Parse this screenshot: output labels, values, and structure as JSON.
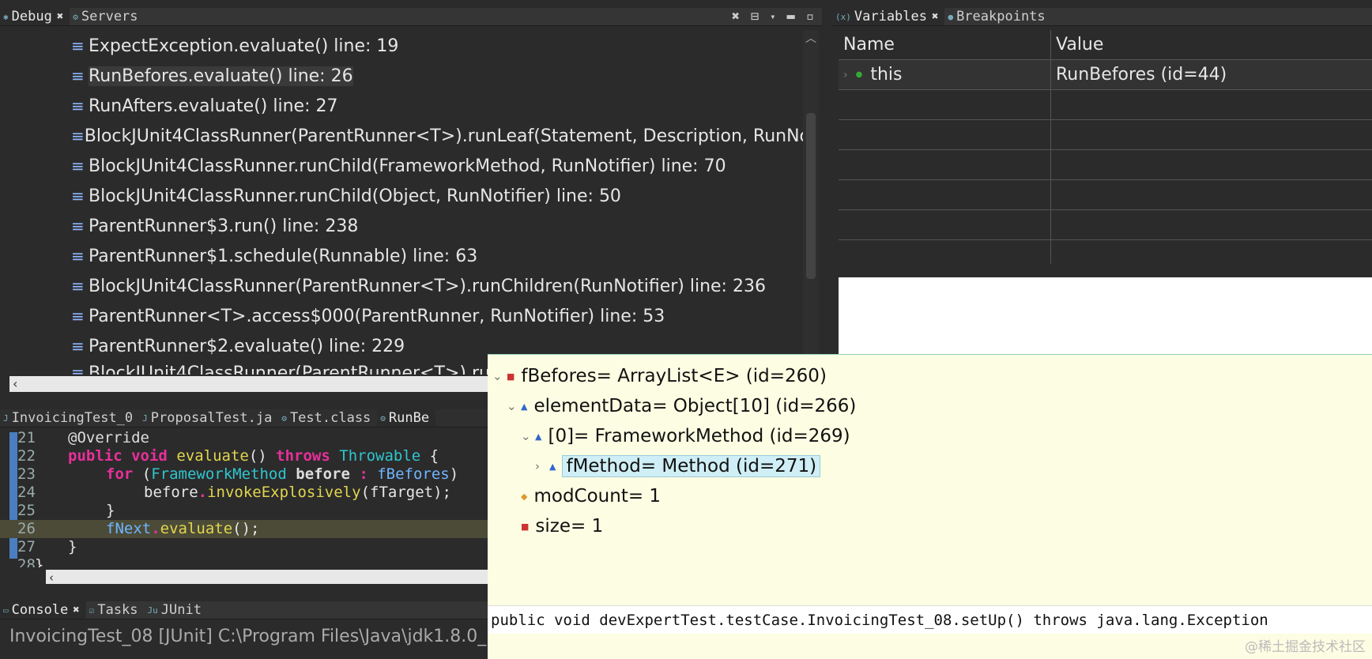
{
  "debug_view": {
    "tabs": [
      {
        "label": "Debug",
        "active": true
      },
      {
        "label": "Servers",
        "active": false
      }
    ],
    "frames": [
      "ExpectException.evaluate() line: 19",
      "RunBefores.evaluate() line: 26",
      "RunAfters.evaluate() line: 27",
      "BlockJUnit4ClassRunner(ParentRunner<T>).runLeaf(Statement, Description, RunNo",
      "BlockJUnit4ClassRunner.runChild(FrameworkMethod, RunNotifier) line: 70",
      "BlockJUnit4ClassRunner.runChild(Object, RunNotifier) line: 50",
      "ParentRunner$3.run() line: 238",
      "ParentRunner$1.schedule(Runnable) line: 63",
      "BlockJUnit4ClassRunner(ParentRunner<T>).runChildren(RunNotifier) line: 236",
      "ParentRunner<T>.access$000(ParentRunner, RunNotifier) line: 53",
      "ParentRunner$2.evaluate() line: 229",
      "BlockJUnit4ClassRunner(ParentRunner<T>).ru"
    ],
    "selected_index": 1
  },
  "variables_view": {
    "tabs": [
      {
        "label": "Variables",
        "active": true
      },
      {
        "label": "Breakpoints",
        "active": false
      }
    ],
    "columns": [
      "Name",
      "Value"
    ],
    "rows": [
      {
        "name": "this",
        "value": "RunBefores  (id=44)"
      }
    ]
  },
  "editor": {
    "tabs": [
      "InvoicingTest_0",
      "ProposalTest.ja",
      "Test.class",
      "RunBe"
    ],
    "line_numbers": [
      "21",
      "22",
      "23",
      "24",
      "25",
      "26",
      "27",
      "28"
    ],
    "lines": [
      [
        "@Override"
      ],
      [
        "public",
        " ",
        "void",
        " ",
        "evaluate",
        "() ",
        "throws",
        " ",
        "Throwable",
        " {"
      ],
      [
        "for",
        " (",
        "FrameworkMethod",
        " ",
        "before",
        " : ",
        "fBefores",
        ")"
      ],
      [
        "before",
        ".",
        "invokeExplosively",
        "(",
        "fTarget",
        ");"
      ],
      [
        "}"
      ],
      [
        "fNext",
        ".",
        "evaluate",
        "();"
      ],
      [
        "}"
      ],
      [
        "}"
      ]
    ],
    "current_line": "26"
  },
  "inspect_popup": {
    "tree": [
      {
        "label": "fBefores= ArrayList<E>  (id=260)",
        "twisty": "⌄",
        "depth": 0
      },
      {
        "label": "elementData= Object[10]  (id=266)",
        "twisty": "⌄",
        "depth": 1
      },
      {
        "label": "[0]= FrameworkMethod  (id=269)",
        "twisty": "⌄",
        "depth": 2
      },
      {
        "label": "fMethod= Method  (id=271)",
        "twisty": "›",
        "depth": 3,
        "selected": true
      },
      {
        "label": "modCount= 1",
        "twisty": "",
        "depth": 1
      },
      {
        "label": "size= 1",
        "twisty": "",
        "depth": 1
      }
    ],
    "signature": "public void devExpertTest.testCase.InvoicingTest_08.setUp() throws java.lang.Exception"
  },
  "console_view": {
    "tabs": [
      "Console",
      "Tasks",
      "JUnit"
    ],
    "launch_text": "InvoicingTest_08 [JUnit] C:\\Program Files\\Java\\jdk1.8.0_"
  },
  "watermark": "@稀土掘金技术社区",
  "colors": {
    "background": "#2b2b2b",
    "popup_background": "#fdfde3",
    "keyword": "#e8309a",
    "method": "#e2d54e",
    "type": "#2fc6cf",
    "selected_node": "#cfeef5"
  }
}
